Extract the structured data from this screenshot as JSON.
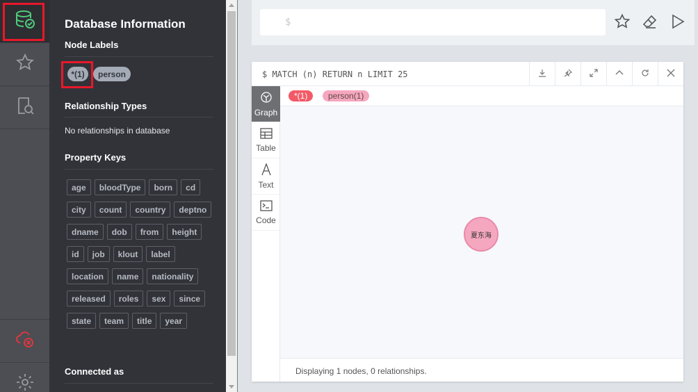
{
  "drawer": {
    "title": "Database Information",
    "node_labels_title": "Node Labels",
    "node_labels": [
      "*(1)",
      "person"
    ],
    "relationship_types_title": "Relationship Types",
    "no_relationships": "No relationships in database",
    "property_keys_title": "Property Keys",
    "property_keys": [
      "age",
      "bloodType",
      "born",
      "cd",
      "city",
      "count",
      "country",
      "deptno",
      "dname",
      "dob",
      "from",
      "height",
      "id",
      "job",
      "klout",
      "label",
      "location",
      "name",
      "nationality",
      "released",
      "roles",
      "sex",
      "since",
      "state",
      "team",
      "title",
      "year"
    ],
    "connected_as_title": "Connected as"
  },
  "rail": {
    "icons": [
      "database-icon",
      "star-icon",
      "search-doc-icon",
      "cloud-disconnected-icon",
      "gear-icon"
    ]
  },
  "editor": {
    "prompt": "$"
  },
  "frame": {
    "query": "$ MATCH (n) RETURN n LIMIT 25",
    "tabs": [
      "Graph",
      "Table",
      "Text",
      "Code"
    ],
    "tag_all": "*(1)",
    "tag_person": "person(1)",
    "node_caption": "夏东海",
    "footer": "Displaying 1 nodes, 0 relationships."
  },
  "colors": {
    "accent_green": "#4fcb7d",
    "highlight_red": "#e8182a",
    "tag_all_bg": "#f25a67",
    "tag_person_bg": "#f6a7c0",
    "node_fill": "#f6a7c0"
  }
}
